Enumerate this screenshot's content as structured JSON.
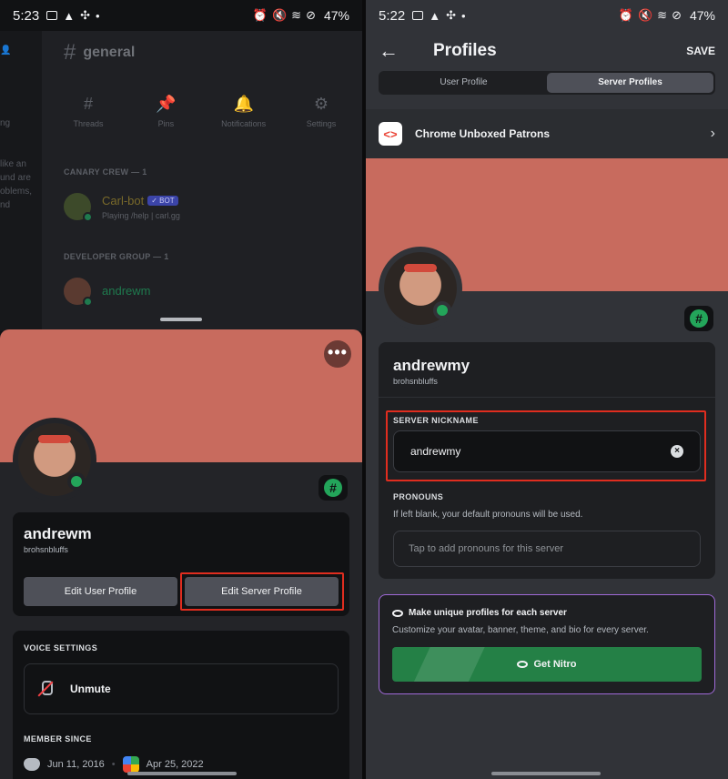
{
  "left": {
    "status": {
      "time": "5:23",
      "battery": "47%"
    },
    "channel": {
      "name": "general",
      "tools": [
        "Threads",
        "Pins",
        "Notifications",
        "Settings"
      ],
      "side_peek": [
        "ng",
        "like an",
        "und are",
        "oblems,",
        "nd"
      ],
      "sections": [
        {
          "header": "CANARY CREW — 1",
          "member_name": "Carl-bot",
          "tag": "✓ BOT",
          "sub": "Playing /help | carl.gg"
        },
        {
          "header": "DEVELOPER GROUP — 1",
          "member_name": "andrewm"
        }
      ]
    },
    "profile": {
      "more": "•••",
      "display_name": "andrewm",
      "username": "brohsnbluffs",
      "edit_user_label": "Edit User Profile",
      "edit_server_label": "Edit Server Profile",
      "voice_caption": "VOICE SETTINGS",
      "unmute_label": "Unmute",
      "member_since_caption": "MEMBER SINCE",
      "discord_since": "Jun 11, 2016",
      "server_since": "Apr 25, 2022",
      "badge": "#"
    }
  },
  "right": {
    "status": {
      "time": "5:22",
      "battery": "47%"
    },
    "title": "Profiles",
    "save_label": "SAVE",
    "tabs": [
      "User Profile",
      "Server Profiles"
    ],
    "server": {
      "name": "Chrome Unboxed Patrons",
      "logo": "<>"
    },
    "display_name": "andrewmy",
    "username": "brohsnbluffs",
    "nickname_caption": "SERVER NICKNAME",
    "nickname_value": "andrewmy",
    "pronouns_caption": "PRONOUNS",
    "pronouns_hint": "If left blank, your default pronouns will be used.",
    "pronouns_placeholder": "Tap to add pronouns for this server",
    "nitro": {
      "title": "Make unique profiles for each server",
      "desc": "Customize your avatar, banner, theme, and bio for every server.",
      "button": "Get Nitro"
    },
    "badge": "#"
  },
  "colors": {
    "banner": "#c86b5e",
    "online": "#23a55a",
    "highlight": "#e02d1f",
    "nitro_green": "#248046",
    "nitro_border": "#a06ad8"
  }
}
